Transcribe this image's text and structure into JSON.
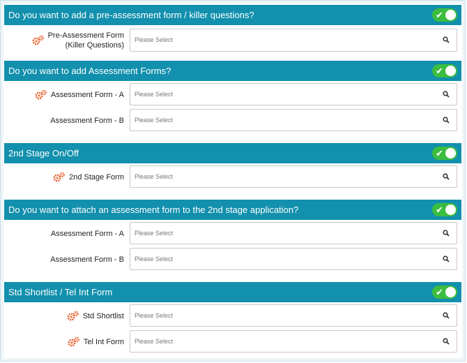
{
  "colors": {
    "header_bg": "#1290ad",
    "toggle_on": "#3bbd3f",
    "gear_orange": "#e8612c"
  },
  "icons": {
    "gear": "gear-icon",
    "search": "search-icon",
    "toggle_check": "check-icon"
  },
  "sections": [
    {
      "title": "Do you want to add a pre-assessment form / killer questions?",
      "toggle_on": true,
      "rows": [
        {
          "label_line1": "Pre-Assessment Form",
          "label_line2": "(Killer Questions)",
          "placeholder": "Please Select",
          "gear": true
        }
      ]
    },
    {
      "title": "Do you want to add Assessment Forms?",
      "toggle_on": true,
      "rows": [
        {
          "label_line1": "Assessment Form - A",
          "placeholder": "Please Select",
          "gear": true
        },
        {
          "label_line1": "Assessment Form - B",
          "placeholder": "Please Select",
          "gear": false
        }
      ]
    },
    {
      "title": "2nd Stage On/Off",
      "toggle_on": true,
      "rows": [
        {
          "label_line1": "2nd Stage Form",
          "placeholder": "Please Select",
          "gear": true
        }
      ]
    },
    {
      "title": "Do you want to attach an assessment form to the 2nd stage application?",
      "toggle_on": true,
      "rows": [
        {
          "label_line1": "Assessment Form - A",
          "placeholder": "Please Select",
          "gear": false
        },
        {
          "label_line1": "Assessment Form - B",
          "placeholder": "Please Select",
          "gear": false
        }
      ]
    },
    {
      "title": "Std Shortlist / Tel Int Form",
      "toggle_on": true,
      "rows": [
        {
          "label_line1": "Std Shortlist",
          "placeholder": "Please Select",
          "gear": true
        },
        {
          "label_line1": "Tel Int Form",
          "placeholder": "Please Select",
          "gear": true
        }
      ]
    }
  ]
}
